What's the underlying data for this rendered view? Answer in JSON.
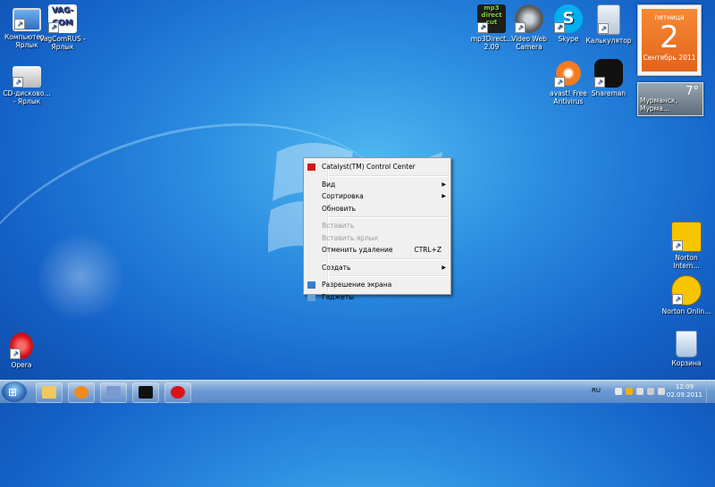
{
  "desktop_icons_left": [
    {
      "id": "computer",
      "label": "Компьютер - Ярлык",
      "color": "#2e6fbf"
    },
    {
      "id": "vagcomrus",
      "label": "VagComRUS - Ярлык",
      "color": "#ffffff"
    },
    {
      "id": "cd-drive",
      "label": "CD-дисково... - Ярлык",
      "color": "#e9e9e9"
    },
    {
      "id": "opera",
      "label": "Opera",
      "color": "#d8141b"
    }
  ],
  "vag_logo_text": "VAG-COM",
  "desktop_icons_right": [
    {
      "id": "mp3directcut",
      "label": "mp3Direct... 2.09",
      "color": "#1e1e1e"
    },
    {
      "id": "videowebcamera",
      "label": "Video Web Camera",
      "color": "#5a5a5a"
    },
    {
      "id": "skype",
      "label": "Skype",
      "color": "#00aff0"
    },
    {
      "id": "calculator",
      "label": "Калькулятор",
      "color": "#cfd8e4"
    },
    {
      "id": "avast",
      "label": "avast! Free Antivirus",
      "color": "#f47b20"
    },
    {
      "id": "shareman",
      "label": "Shareman",
      "color": "#111111"
    },
    {
      "id": "norton-internet",
      "label": "Norton Intern...",
      "color": "#f6c400"
    },
    {
      "id": "norton-online",
      "label": "Norton Onlin...",
      "color": "#f6c400"
    },
    {
      "id": "recycle",
      "label": "Корзина",
      "color": "#d7e6f5"
    }
  ],
  "mp3_logo_text": "mp3 direct cut",
  "context_menu": {
    "catalyst": "Catalyst(TM) Control Center",
    "view": "Вид",
    "sort": "Сортировка",
    "refresh": "Обновить",
    "paste": "Вставить",
    "paste_shortcut": "Вставить ярлык",
    "undo_delete": "Отменить удаление",
    "undo_shortcut": "CTRL+Z",
    "create": "Создать",
    "resolution": "Разрешение экрана",
    "gadgets": "Гаджеты"
  },
  "calendar": {
    "weekday": "пятница",
    "day": "2",
    "month": "Сентябрь 2011"
  },
  "weather": {
    "temp": "7°",
    "city": "Мурманск, Мурма..."
  },
  "taskbar": {
    "lang": "RU",
    "time": "12:09",
    "date": "02.09.2011",
    "colors": {
      "explorer": "#f0c860",
      "media": "#f08a20",
      "tool": "#7a9ad0",
      "shareman": "#111111",
      "opera": "#d8141b"
    }
  }
}
